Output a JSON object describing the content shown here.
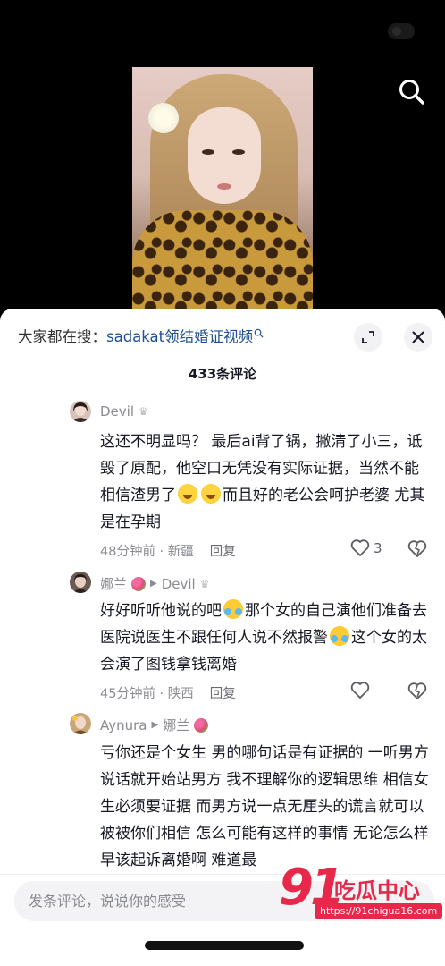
{
  "sheet": {
    "trending_prefix": "大家都在搜：",
    "trending_query": "sadakat领结婚证视频",
    "comment_count": "433条评论"
  },
  "comments": [
    {
      "username": "Devil",
      "text_1": "这还不明显吗？ 最后ai背了锅，撇清了小三，诋毁了原配，他空口无凭没有实际证据，当然不能相信渣男了",
      "text_2": "而且好的老公会呵护老婆 尤其是在孕期",
      "time_location": "48分钟前 · 新疆",
      "reply_label": "回复",
      "likes": "3"
    },
    {
      "username": "娜兰",
      "reply_to": "Devil",
      "text_1": "好好听听他说的吧",
      "text_2": "那个女的自己演他们准备去医院说医生不跟任何人说不然报警",
      "text_3": "这个女的太会演了图钱拿钱离婚",
      "time_location": "45分钟前 · 陕西",
      "reply_label": "回复"
    },
    {
      "username": "Aynura",
      "reply_to": "娜兰",
      "text_1": "亏你还是个女生 男的哪句话是有证据的 一听男方说话就开始站男方 我不理解你的逻辑思维 相信女生必须要证据 而男方说一点无厘头的谎言就可以被被你们相信 怎么可能有这样的事情 无论怎么样 早该起诉离婚啊 难道最"
    }
  ],
  "input": {
    "placeholder": "发条评论，说说你的感受"
  },
  "watermark": {
    "number": "91",
    "name": "吃瓜中心",
    "url": "https://91chigua16.com"
  },
  "icons": {
    "search": "search-icon",
    "expand": "expand-icon",
    "close": "close-icon",
    "like": "heart-icon",
    "dislike": "broken-heart-icon",
    "reply_arrow": "play-triangle-icon"
  },
  "colors": {
    "accent_link": "#1e4f8f",
    "watermark_red": "#e8284a",
    "secondary_text": "#8a8b91"
  }
}
